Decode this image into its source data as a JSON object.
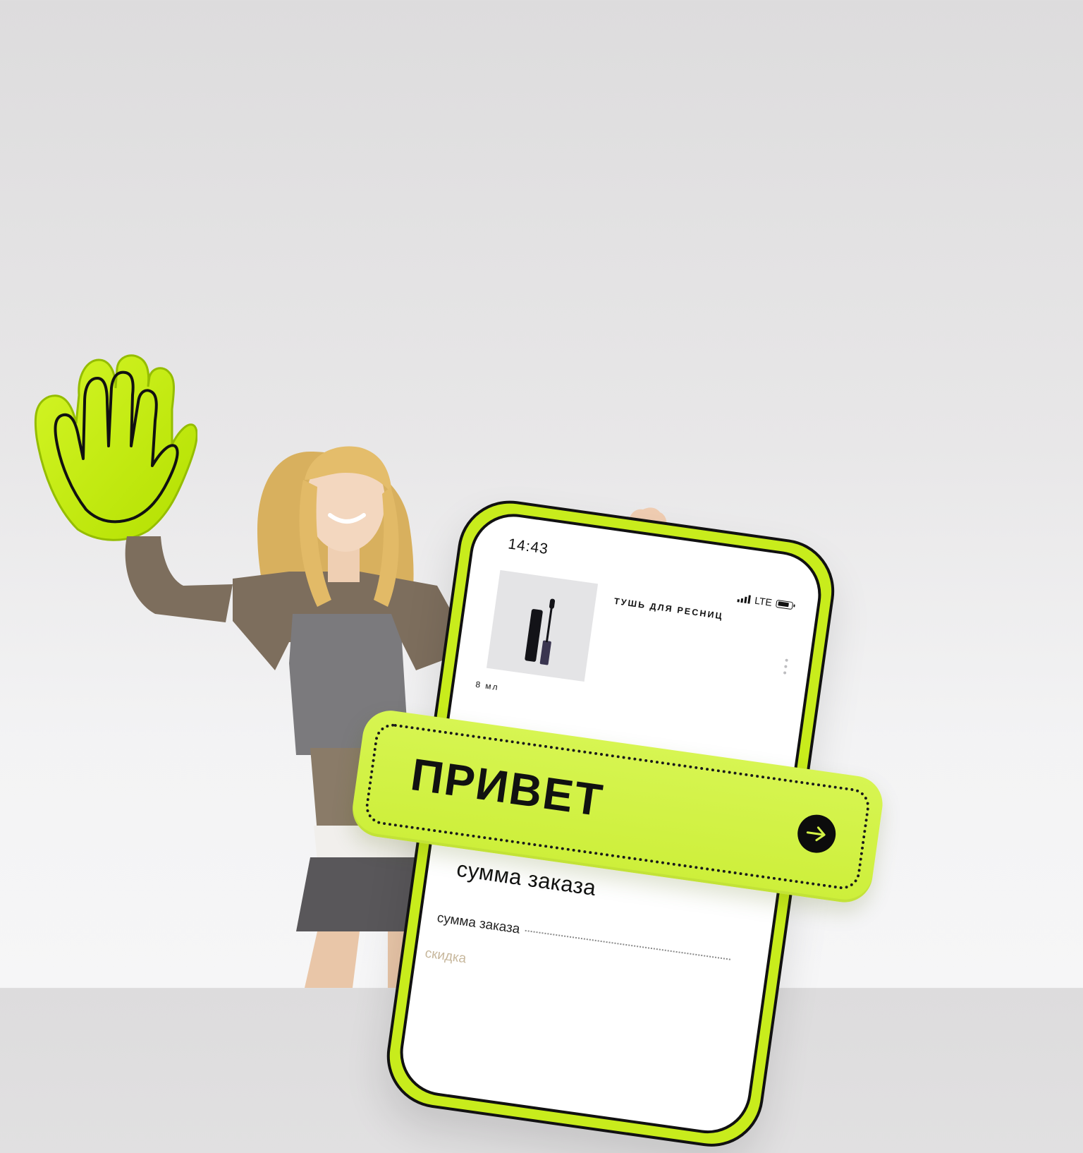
{
  "phone": {
    "status_time": "14:43",
    "network": "LTE",
    "product": {
      "title": "ТУШЬ ДЛЯ РЕСНИЦ",
      "volume": "8 мл"
    },
    "order": {
      "heading": "сумма заказа",
      "row_label": "сумма заказа",
      "discount_label": "скидка"
    }
  },
  "banner": {
    "text": "ПРИВЕТ",
    "arrow_icon": "arrow-right-icon"
  },
  "icons": {
    "hand": "foam-hand-icon",
    "signal": "signal-icon",
    "battery": "battery-icon",
    "more": "more-vertical-icon"
  },
  "colors": {
    "accent": "#c8ec1c",
    "banner": "#d3f346",
    "ink": "#111111",
    "discount": "#c7b79c"
  }
}
